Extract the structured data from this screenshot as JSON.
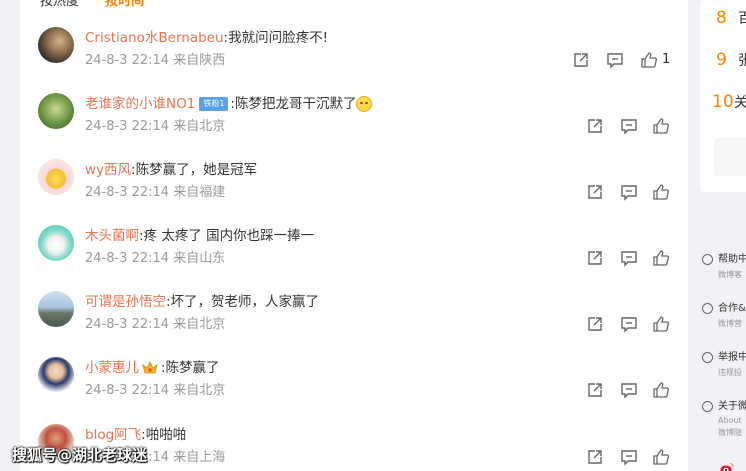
{
  "tabs": {
    "hot": "按热度",
    "time": "按时间"
  },
  "comments": [
    {
      "user": "Cristiano水Bernabeu",
      "text": ":我就问问脸疼不!",
      "time": "24-8-3 22:14",
      "location": "来自陕西",
      "likes": "1"
    },
    {
      "user": "老谁家的小谁NO1",
      "badge": "铁粉1",
      "text": ":陈梦把龙哥干沉默了",
      "time": "24-8-3 22:14",
      "location": "来自北京"
    },
    {
      "user": "wy西风",
      "text": ":陈梦赢了，她是冠军",
      "time": "24-8-3 22:14",
      "location": "来自福建"
    },
    {
      "user": "木头菌啊",
      "text": ":疼 太疼了 国内你也踩一捧一",
      "time": "24-8-3 22:14",
      "location": "来自山东"
    },
    {
      "user": "可谓是孙悟空",
      "text": ":坏了，贺老师，人家赢了",
      "time": "24-8-3 22:14",
      "location": "来自北京"
    },
    {
      "user": "小蒙惠儿",
      "text": ":陈梦赢了",
      "time": "24-8-3 22:14",
      "location": "来自北京"
    },
    {
      "user": "blog阿飞",
      "text": ":啪啪啪",
      "time": "24-8-3 22:14",
      "location": "来自上海"
    }
  ],
  "icons": {
    "share": "share-icon",
    "comment": "comment-icon",
    "like": "like-icon"
  },
  "ranking": [
    {
      "num": "8",
      "text": "百"
    },
    {
      "num": "9",
      "text": "张"
    },
    {
      "num": "10",
      "text": "关"
    }
  ],
  "help_links": [
    {
      "title": "帮助中",
      "sub": "微博客"
    },
    {
      "title": "合作&",
      "sub": "微博营"
    },
    {
      "title": "举报中",
      "sub": "违规投"
    },
    {
      "title": "关于微",
      "sub": "About",
      "sub2": "微博隐"
    }
  ],
  "watermark": "搜狐号@湖北老球迷",
  "colors": {
    "username": "#eb7350",
    "accent": "#ff8200",
    "meta": "#999999"
  }
}
